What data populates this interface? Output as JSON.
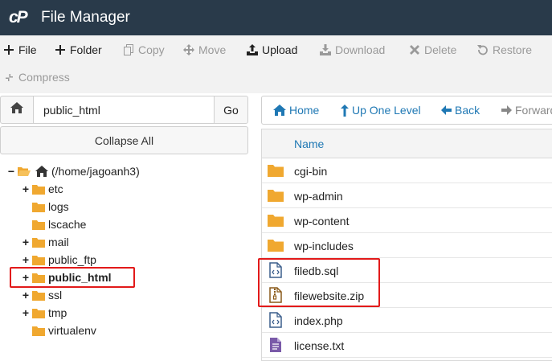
{
  "header": {
    "title": "File Manager",
    "logo": "cP"
  },
  "toolbar": {
    "file": "File",
    "folder": "Folder",
    "copy": "Copy",
    "move": "Move",
    "upload": "Upload",
    "download": "Download",
    "delete": "Delete",
    "restore": "Restore",
    "compress": "Compress"
  },
  "left": {
    "path_value": "public_html",
    "go": "Go",
    "collapse_all": "Collapse All",
    "tree": {
      "root": "(/home/jagoanh3)",
      "items": [
        "etc",
        "logs",
        "lscache",
        "mail",
        "public_ftp",
        "public_html",
        "ssl",
        "tmp",
        "virtualenv"
      ]
    }
  },
  "right": {
    "nav": {
      "home": "Home",
      "up": "Up One Level",
      "back": "Back",
      "forward": "Forward"
    },
    "column_name": "Name",
    "files": [
      "cgi-bin",
      "wp-admin",
      "wp-content",
      "wp-includes",
      "filedb.sql",
      "filewebsite.zip",
      "index.php",
      "license.txt"
    ]
  },
  "colors": {
    "header_bg": "#293a4a",
    "folder": "#f0a830",
    "link": "#1f78b4",
    "highlight": "#e21a1a"
  }
}
